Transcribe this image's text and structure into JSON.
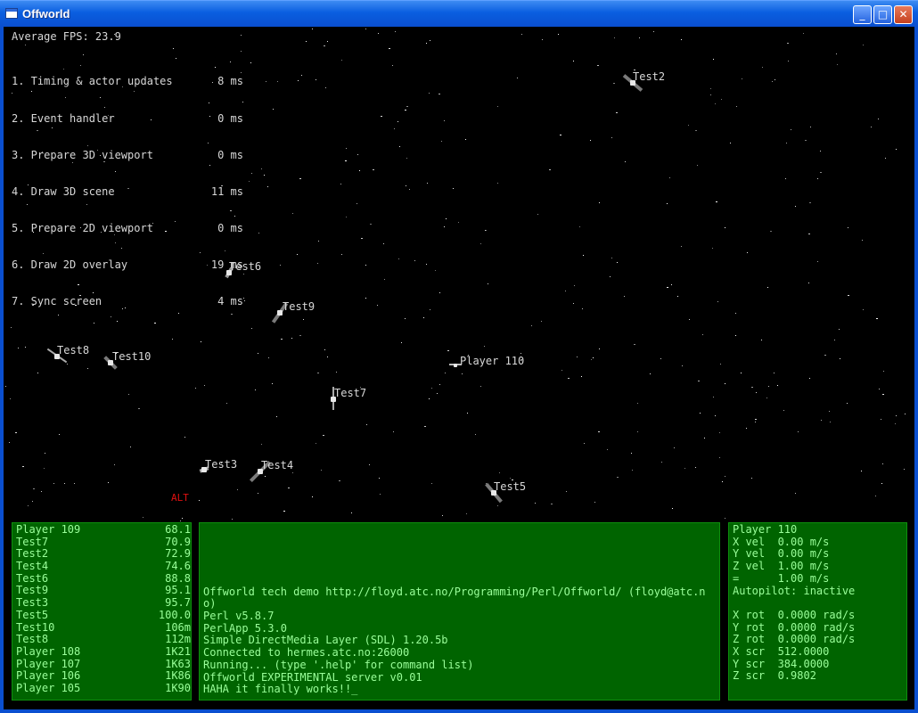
{
  "window": {
    "title": "Offworld",
    "minimize_glyph": "_",
    "maximize_glyph": "□",
    "close_glyph": "✕"
  },
  "hud": {
    "fps": "Average FPS: 23.9",
    "timings": [
      {
        "label": "1. Timing & actor updates",
        "value": "8 ms"
      },
      {
        "label": "2. Event handler",
        "value": "0 ms"
      },
      {
        "label": "3. Prepare 3D viewport",
        "value": "0 ms"
      },
      {
        "label": "4. Draw 3D scene",
        "value": "11 ms"
      },
      {
        "label": "5. Prepare 2D viewport",
        "value": "0 ms"
      },
      {
        "label": "6. Draw 2D overlay",
        "value": "19 ms"
      },
      {
        "label": "7. Sync screen",
        "value": "4 ms"
      }
    ],
    "alt_label": "ALT"
  },
  "ships": [
    {
      "label": "Test2"
    },
    {
      "label": "Test6"
    },
    {
      "label": "Test9"
    },
    {
      "label": "Test8"
    },
    {
      "label": "Test10"
    },
    {
      "label": "Player 110"
    },
    {
      "label": "Test7"
    },
    {
      "label": "Test3"
    },
    {
      "label": "Test4"
    },
    {
      "label": "Test5"
    }
  ],
  "distance_list": [
    {
      "name": "Player 109",
      "value": "68.1"
    },
    {
      "name": "Test7",
      "value": "70.9"
    },
    {
      "name": "Test2",
      "value": "72.9"
    },
    {
      "name": "Test4",
      "value": "74.6"
    },
    {
      "name": "Test6",
      "value": "88.8"
    },
    {
      "name": "Test9",
      "value": "95.1"
    },
    {
      "name": "Test3",
      "value": "95.7"
    },
    {
      "name": "Test5",
      "value": "100.0"
    },
    {
      "name": "Test10",
      "value": "106m"
    },
    {
      "name": "Test8",
      "value": "112m"
    },
    {
      "name": "Player 108",
      "value": "1K21"
    },
    {
      "name": "Player 107",
      "value": "1K63"
    },
    {
      "name": "Player 106",
      "value": "1K86"
    },
    {
      "name": "Player 105",
      "value": "1K90"
    }
  ],
  "console": [
    "Offworld tech demo http://floyd.atc.no/Programming/Perl/Offworld/ (floyd@atc.no)",
    "Perl v5.8.7",
    "PerlApp 5.3.0",
    "Simple DirectMedia Layer (SDL) 1.20.5b",
    "Connected to hermes.atc.no:26000",
    "Running... (type '.help' for command list)",
    "Offworld EXPERIMENTAL server v0.01",
    "HAHA it finally works!!_"
  ],
  "status": {
    "player": "Player 110",
    "lines_a": [
      "X vel  0.00 m/s",
      "Y vel  0.00 m/s",
      "Z vel  1.00 m/s",
      "=      1.00 m/s",
      "Autopilot: inactive"
    ],
    "lines_b": [
      "X rot  0.0000 rad/s",
      "Y rot  0.0000 rad/s",
      "Z rot  0.0000 rad/s",
      "X scr  512.0000",
      "Y scr  384.0000",
      "Z scr  0.9802"
    ]
  },
  "colors": {
    "panel_bg": "#006400",
    "panel_text": "#9aff9a",
    "hud_text": "#d8d8d8",
    "alt_text": "#e01010",
    "titlebar": "#0a5ee0"
  }
}
